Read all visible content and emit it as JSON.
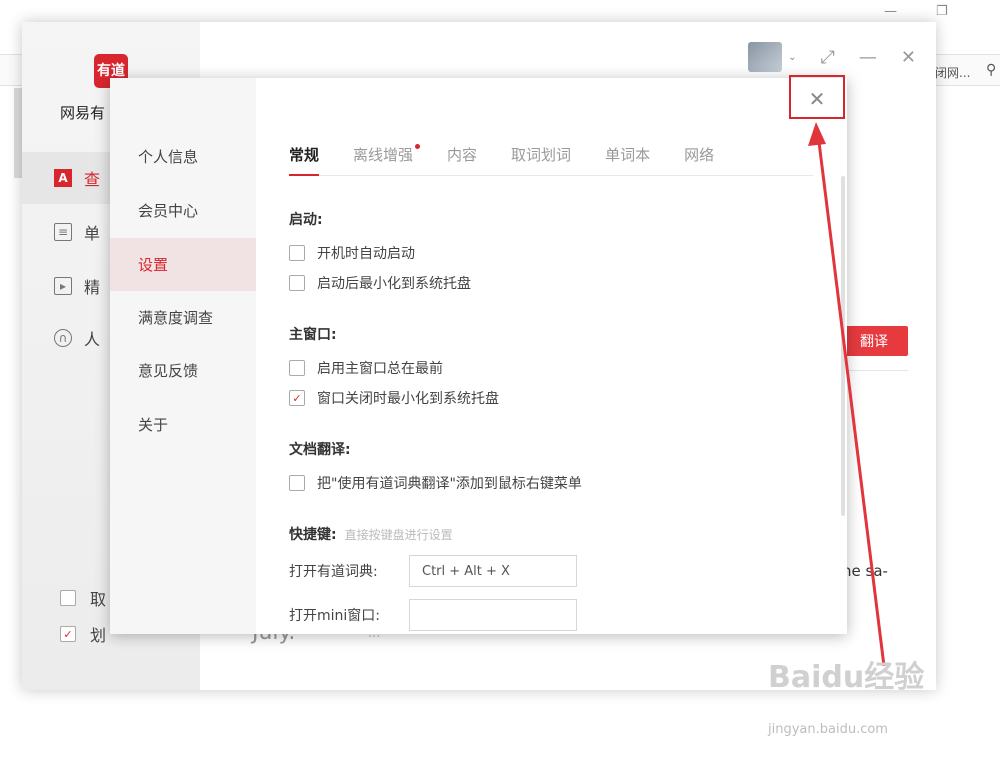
{
  "app": {
    "logo_text": "有道",
    "name": "网易有",
    "nav": [
      {
        "label": "查"
      },
      {
        "label": "单"
      },
      {
        "label": "精"
      },
      {
        "label": "人"
      }
    ],
    "bottom_checks": [
      {
        "label": "取",
        "checked": false
      },
      {
        "label": "划",
        "checked": true
      }
    ],
    "translate_button": "翻译",
    "sample_text": "he sa-",
    "footer_word": "July.",
    "footer_faded": "...",
    "bg_right_text": "闭网..."
  },
  "dialog": {
    "side_nav": [
      {
        "label": "个人信息",
        "active": false
      },
      {
        "label": "会员中心",
        "active": false
      },
      {
        "label": "设置",
        "active": true
      },
      {
        "label": "满意度调查",
        "active": false
      },
      {
        "label": "意见反馈",
        "active": false
      },
      {
        "label": "关于",
        "active": false
      }
    ],
    "tabs": [
      {
        "label": "常规",
        "active": true,
        "dot": false
      },
      {
        "label": "离线增强",
        "active": false,
        "dot": true
      },
      {
        "label": "内容",
        "active": false,
        "dot": false
      },
      {
        "label": "取词划词",
        "active": false,
        "dot": false
      },
      {
        "label": "单词本",
        "active": false,
        "dot": false
      },
      {
        "label": "网络",
        "active": false,
        "dot": false
      }
    ],
    "sections": {
      "startup_title": "启动:",
      "startup_opt1": "开机时自动启动",
      "startup_opt2": "启动后最小化到系统托盘",
      "main_title": "主窗口:",
      "main_opt1": "启用主窗口总在最前",
      "main_opt2": "窗口关闭时最小化到系统托盘",
      "doc_title": "文档翻译:",
      "doc_opt1": "把\"使用有道词典翻译\"添加到鼠标右键菜单",
      "shortcut_title": "快捷键:",
      "shortcut_hint": "直接按键盘进行设置",
      "key1_label": "打开有道词典:",
      "key1_value": "Ctrl + Alt + X",
      "key2_label": "打开mini窗口:",
      "key2_value": ""
    },
    "checks": {
      "startup_opt1": false,
      "startup_opt2": false,
      "main_opt1": false,
      "main_opt2": true,
      "doc_opt1": false
    },
    "close_glyph": "✕"
  },
  "watermark": {
    "main": "Baidu经验",
    "sub": "jingyan.baidu.com"
  },
  "colors": {
    "accent": "#d8262f",
    "annotation": "#e0353b"
  },
  "icons": {
    "check": "✓",
    "close": "✕",
    "minimize": "—",
    "maximize": "⤢",
    "chevron": "⌄"
  }
}
